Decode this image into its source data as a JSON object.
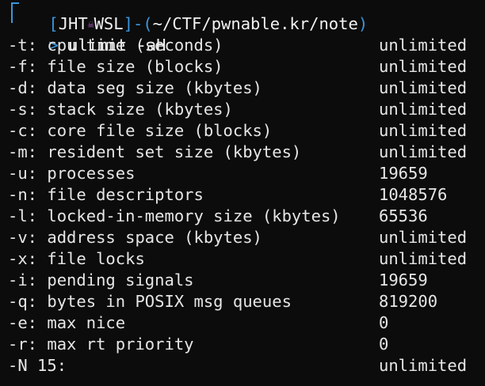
{
  "prompt": {
    "open_bracket": "[",
    "user": "JHT",
    "skull_icon": "☠",
    "host": "WSL",
    "close_bracket": "]",
    "dash": "-",
    "path_open": "(",
    "path": "~/CTF/pwnable.kr/note",
    "path_close": ")",
    "arrow": "> ",
    "command": "ulimit -aH"
  },
  "rows": [
    {
      "label": "-t: cpu time (seconds)",
      "value": "unlimited"
    },
    {
      "label": "-f: file size (blocks)",
      "value": "unlimited"
    },
    {
      "label": "-d: data seg size (kbytes)",
      "value": "unlimited"
    },
    {
      "label": "-s: stack size (kbytes)",
      "value": "unlimited"
    },
    {
      "label": "-c: core file size (blocks)",
      "value": "unlimited"
    },
    {
      "label": "-m: resident set size (kbytes)",
      "value": "unlimited"
    },
    {
      "label": "-u: processes",
      "value": "19659"
    },
    {
      "label": "-n: file descriptors",
      "value": "1048576"
    },
    {
      "label": "-l: locked-in-memory size (kbytes)",
      "value": "65536"
    },
    {
      "label": "-v: address space (kbytes)",
      "value": "unlimited"
    },
    {
      "label": "-x: file locks",
      "value": "unlimited"
    },
    {
      "label": "-i: pending signals",
      "value": "19659"
    },
    {
      "label": "-q: bytes in POSIX msg queues",
      "value": "819200"
    },
    {
      "label": "-e: max nice",
      "value": "0"
    },
    {
      "label": "-r: max rt priority",
      "value": "0"
    },
    {
      "label": "-N 15:",
      "value": "unlimited"
    }
  ],
  "colors": {
    "background": "#0c0c0c",
    "prompt_blue": "#3a96dd",
    "skull_purple": "#b45ec8",
    "text": "#e6e6e6"
  }
}
